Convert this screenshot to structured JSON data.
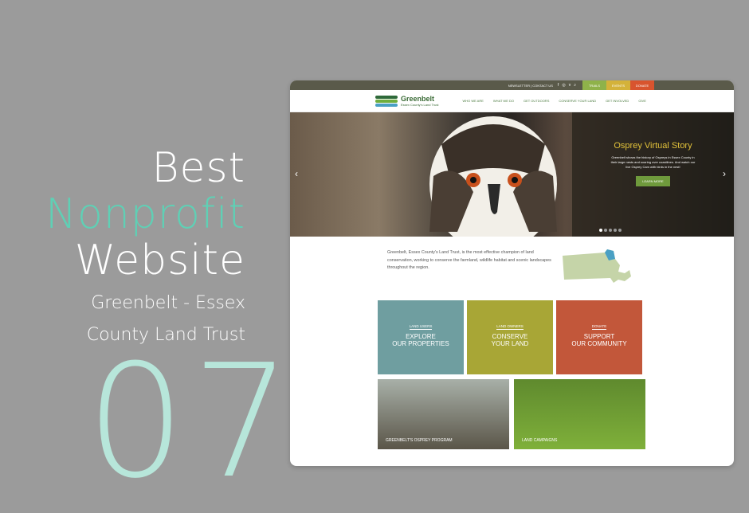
{
  "headline": {
    "line1": "Best",
    "line2": "Nonprofit",
    "line3": "Website",
    "sub1": "Greenbelt - Essex",
    "sub2": "County Land Trust",
    "number": "07"
  },
  "colors": {
    "background": "#9b9b9b",
    "accent": "#5fd0b5",
    "number": "#b7e6da",
    "trails": "#8fb24a",
    "events": "#d4b23a",
    "donate": "#d8542e"
  },
  "site": {
    "utility": {
      "links": "NEWSLETTER | CONTACT US",
      "social": [
        "f",
        "◎",
        "v",
        "⌕"
      ],
      "trails": "TRAILS",
      "events": "EVENTS",
      "donate": "DONATE"
    },
    "logo": {
      "name": "Greenbelt",
      "tagline": "Essex County's Land Trust"
    },
    "nav": [
      "WHO WE ARE",
      "WHAT WE DO",
      "GET OUTDOORS",
      "CONSERVE YOUR LAND",
      "GET INVOLVED",
      "GIVE"
    ],
    "hero": {
      "title": "Osprey Virtual Story",
      "text": "Greenbelt shows the history of Ospreys in Essex County in their large nests and soaring over coastlines. And watch our live Osprey Cam with birds in the nest!",
      "button": "LEARN MORE"
    },
    "intro": "Greenbelt, Essex County's Land Trust, is the most effective champion of land conservation, working to conserve the farmland, wildlife habitat and scenic landscapes throughout the region.",
    "tiles": [
      {
        "small": "LAND USERS",
        "big1": "EXPLORE",
        "big2": "OUR PROPERTIES"
      },
      {
        "small": "LAND OWNERS",
        "big1": "CONSERVE",
        "big2": "YOUR LAND"
      },
      {
        "small": "DONATE",
        "big1": "SUPPORT",
        "big2": "OUR COMMUNITY"
      }
    ],
    "tiles2": [
      {
        "caption": "GREENBELT'S OSPREY PROGRAM"
      },
      {
        "caption": "LAND CAMPAIGNS"
      }
    ]
  }
}
